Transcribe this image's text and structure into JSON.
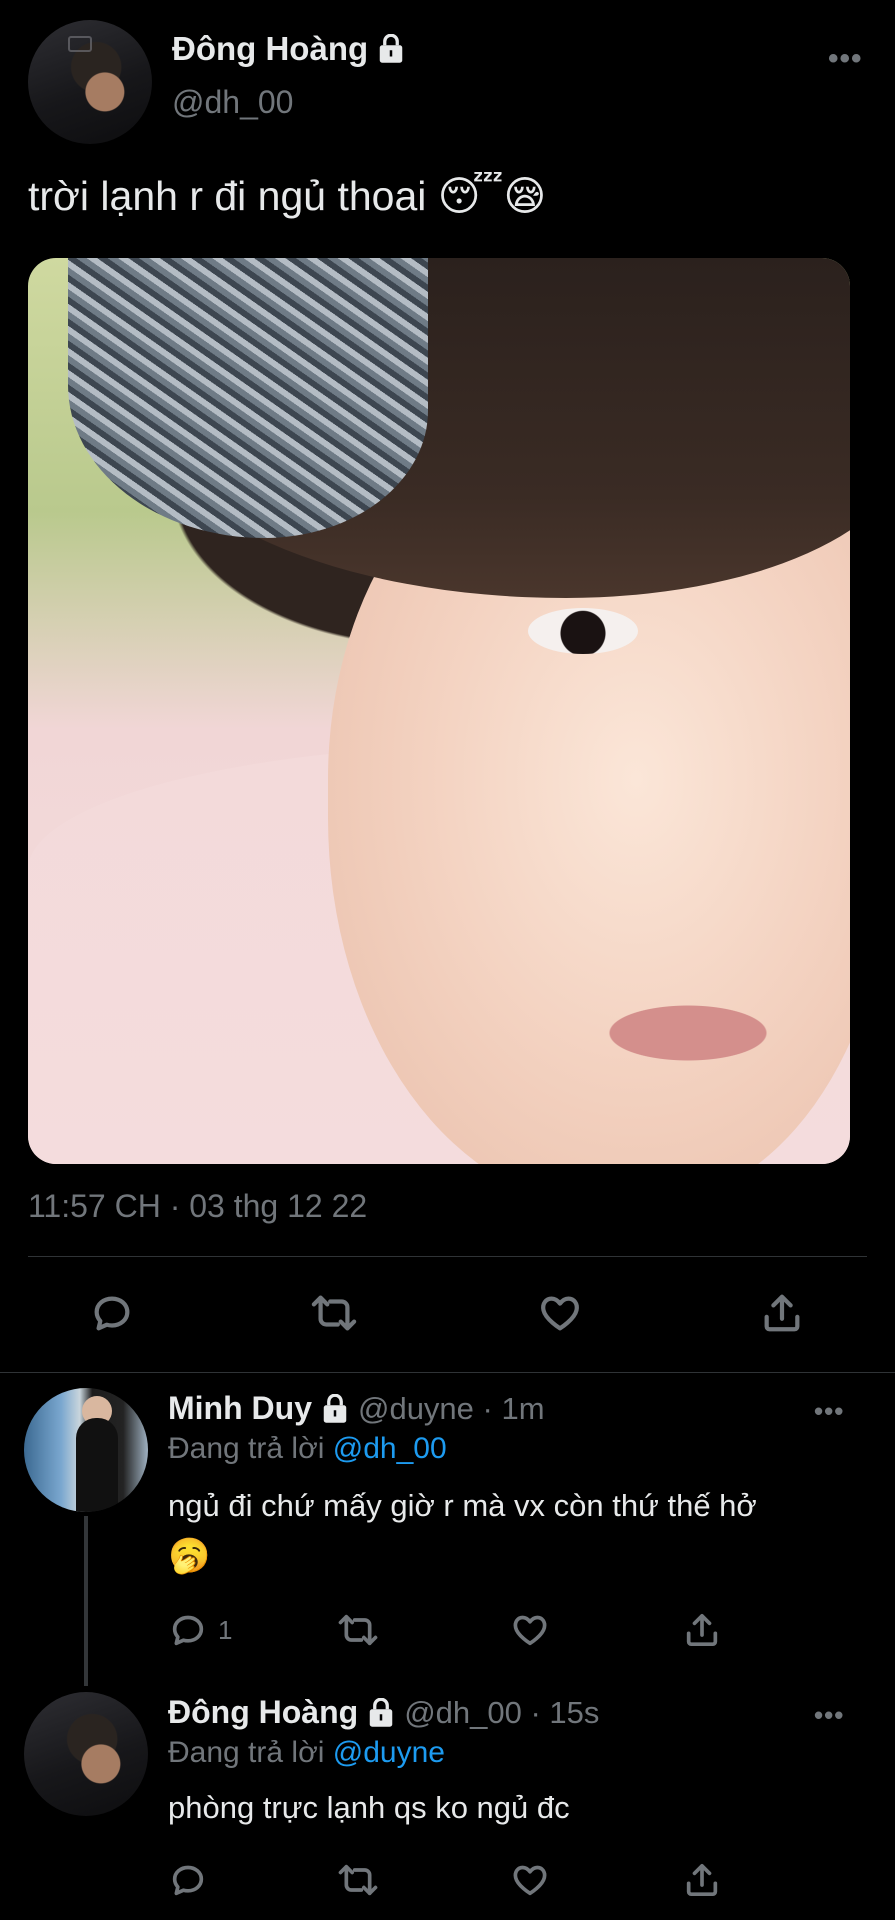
{
  "main_tweet": {
    "author_name": "Đông Hoàng",
    "author_handle": "@dh_00",
    "text": "trời lạnh r đi ngủ thoai 😴😪",
    "timestamp": "11:57 CH · 03 thg 12 22",
    "more": "•••"
  },
  "replies": [
    {
      "author_name": "Minh Duy",
      "handle_time": "@duyne · 1m",
      "replying_prefix": "Đang trả lời",
      "replying_to": "@dh_00",
      "text_line1": "ngủ đi chứ mấy giờ r mà vx còn thứ thế hở",
      "text_line2": "🥱",
      "reply_count": "1",
      "more": "•••"
    },
    {
      "author_name": "Đông Hoàng",
      "handle_time": "@dh_00 · 15s",
      "replying_prefix": "Đang trả lời",
      "replying_to": "@duyne",
      "text_line1": "phòng trực lạnh qs ko ngủ đc",
      "more": "•••"
    }
  ],
  "colors": {
    "background": "#000000",
    "text": "#e7e9ea",
    "muted": "#71767b",
    "accent": "#1d9bf0"
  },
  "icons": [
    "lock-icon",
    "more-icon",
    "reply-icon",
    "retweet-icon",
    "like-icon",
    "share-icon"
  ]
}
